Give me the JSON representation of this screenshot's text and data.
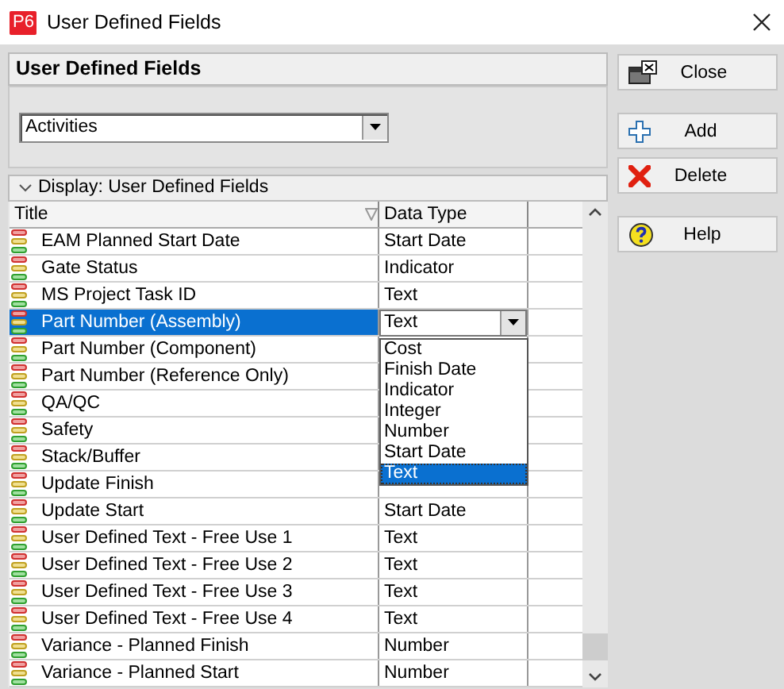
{
  "window": {
    "logo": "P6",
    "title": "User Defined Fields"
  },
  "panel": {
    "title": "User Defined Fields",
    "subject": "Activities"
  },
  "grid": {
    "group": "Display: User Defined Fields",
    "columns": [
      "Title",
      "Data Type"
    ],
    "rows": [
      {
        "title": "EAM Planned Start Date",
        "data_type": "Start Date",
        "selected": false
      },
      {
        "title": "Gate Status",
        "data_type": "Indicator",
        "selected": false
      },
      {
        "title": "MS Project Task ID",
        "data_type": "Text",
        "selected": false
      },
      {
        "title": "Part Number (Assembly)",
        "data_type": "Text",
        "selected": true
      },
      {
        "title": "Part Number (Component)",
        "selected": false
      },
      {
        "title": "Part Number (Reference Only)",
        "selected": false
      },
      {
        "title": "QA/QC",
        "selected": false
      },
      {
        "title": "Safety",
        "selected": false
      },
      {
        "title": "Stack/Buffer",
        "selected": false
      },
      {
        "title": "Update Finish",
        "selected": false
      },
      {
        "title": "Update Start",
        "data_type": "Start Date",
        "selected": false
      },
      {
        "title": "User Defined Text - Free Use 1",
        "data_type": "Text",
        "selected": false
      },
      {
        "title": "User Defined Text - Free Use 2",
        "data_type": "Text",
        "selected": false
      },
      {
        "title": "User Defined Text - Free Use 3",
        "data_type": "Text",
        "selected": false
      },
      {
        "title": "User Defined Text - Free Use 4",
        "data_type": "Text",
        "selected": false
      },
      {
        "title": "Variance - Planned Finish",
        "data_type": "Number",
        "selected": false
      },
      {
        "title": "Variance - Planned Start",
        "data_type": "Number",
        "selected": false
      }
    ],
    "options": [
      {
        "label": "Cost",
        "selected": false
      },
      {
        "label": "Finish Date",
        "selected": false
      },
      {
        "label": "Indicator",
        "selected": false
      },
      {
        "label": "Integer",
        "selected": false
      },
      {
        "label": "Number",
        "selected": false
      },
      {
        "label": "Start Date",
        "selected": false
      },
      {
        "label": "Text",
        "selected": true
      }
    ]
  },
  "buttons": [
    {
      "label": "Close",
      "kind": "close"
    },
    {
      "label": "Add",
      "kind": "add"
    },
    {
      "label": "Delete",
      "kind": "delete"
    },
    {
      "label": "Help",
      "kind": "help"
    }
  ]
}
